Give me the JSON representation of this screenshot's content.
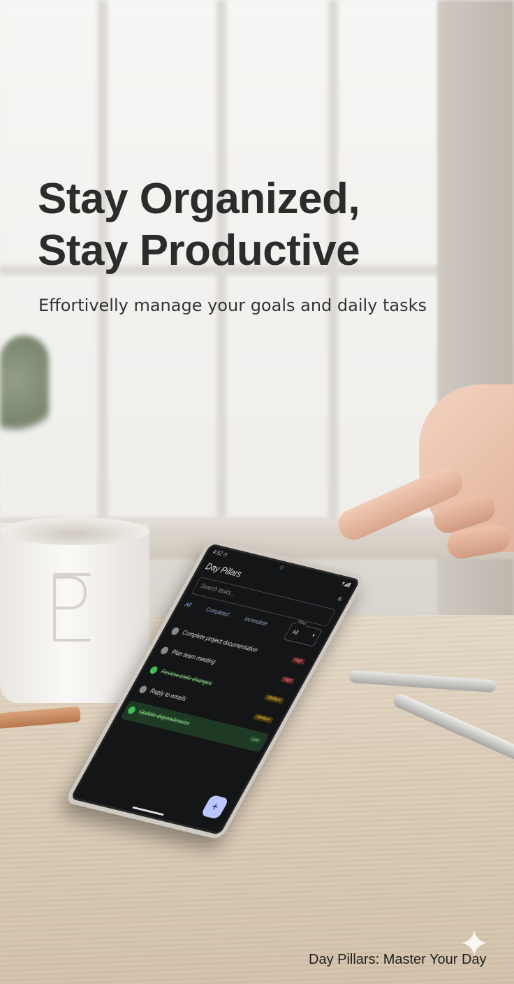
{
  "hero": {
    "headline_line1": "Stay Organized,",
    "headline_line2": "Stay Productive",
    "subheadline": "Effortivelly manage your goals and daily tasks"
  },
  "caption": "Day Pillars: Master Your Day",
  "phone_app": {
    "status_time": "4:52 ⊙",
    "status_icons": "▾◢▮",
    "title": "Day Pillars",
    "menu_icon": "filter-list-icon",
    "search_placeholder": "Search tasks...",
    "tabs": [
      {
        "label": "All",
        "active": true
      },
      {
        "label": "Completed",
        "active": false
      },
      {
        "label": "Incomplete",
        "active": false
      }
    ],
    "filter": {
      "label": "Filter",
      "value": "All"
    },
    "tasks": [
      {
        "title": "Complete project documentation",
        "priority": "High",
        "done": false
      },
      {
        "title": "Plan team meeting",
        "priority": "High",
        "done": false
      },
      {
        "title": "Review code changes",
        "priority": "Medium",
        "done": true
      },
      {
        "title": "Reply to emails",
        "priority": "Medium",
        "done": false
      },
      {
        "title": "Update dependencies",
        "priority": "Low",
        "done": true
      }
    ],
    "fab_label": "+"
  },
  "colors": {
    "headline": "#2c2c2c",
    "screen_bg": "#141517",
    "accent": "#b9c6ff",
    "high": "#ff8c8c",
    "medium": "#f2c04a",
    "low": "#8fe39b"
  }
}
